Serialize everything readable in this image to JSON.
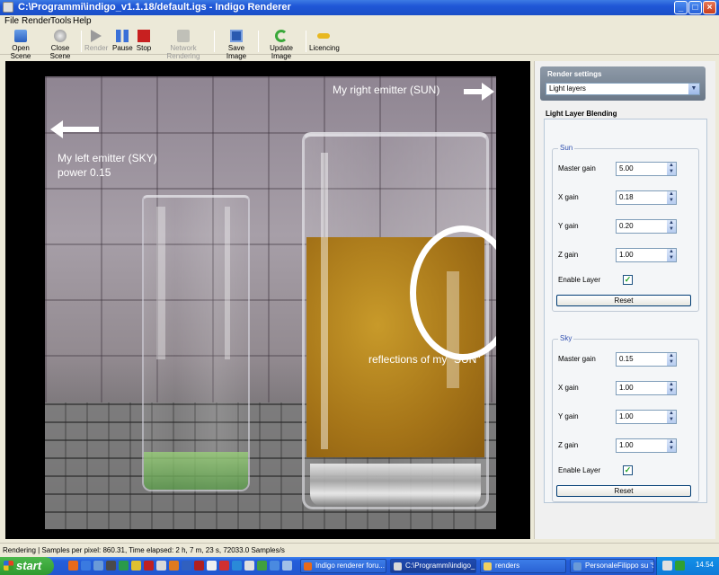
{
  "window": {
    "title": "C:\\Programmi\\indigo_v1.1.18/default.igs - Indigo Renderer"
  },
  "menu": [
    "File",
    "Render",
    "Tools",
    "Help"
  ],
  "toolbar": {
    "open_scene": "Open Scene",
    "close_scene": "Close Scene",
    "render": "Render",
    "pause": "Pause",
    "stop": "Stop",
    "network_rendering": "Network Rendering",
    "save_image": "Save Image",
    "update_image": "Update Image",
    "licencing": "Licencing"
  },
  "annotations": {
    "left_emitter_line1": "My left emitter (SKY)",
    "left_emitter_line2": "power 0.15",
    "right_emitter": "My right emitter (SUN)",
    "reflections": "reflections of my \"SUN\""
  },
  "panel": {
    "header": "Render settings",
    "dropdown_value": "Light layers",
    "section_title": "Light Layer Blending",
    "sun": {
      "title": "Sun",
      "master_gain_label": "Master gain",
      "master_gain": "5.00",
      "x_gain_label": "X gain",
      "x_gain": "0.18",
      "y_gain_label": "Y gain",
      "y_gain": "0.20",
      "z_gain_label": "Z gain",
      "z_gain": "1.00",
      "enable_label": "Enable Layer",
      "enabled": true,
      "reset": "Reset"
    },
    "sky": {
      "title": "Sky",
      "master_gain_label": "Master gain",
      "master_gain": "0.15",
      "x_gain_label": "X gain",
      "x_gain": "1.00",
      "y_gain_label": "Y gain",
      "y_gain": "1.00",
      "z_gain_label": "Z gain",
      "z_gain": "1.00",
      "enable_label": "Enable Layer",
      "enabled": true,
      "reset": "Reset"
    }
  },
  "status": "Rendering | Samples per pixel: 860.31, Time elapsed: 2 h, 7 m, 23 s, 72033.0 Samples/s",
  "taskbar": {
    "start": "start",
    "tasks": [
      "Indigo renderer foru...",
      "C:\\Programmi\\indigo_...",
      "renders",
      "PersonaleFilippo su 'S..."
    ],
    "clock": "14.54"
  },
  "colors": {
    "titlebar": "#245edb",
    "accent": "#3050b0",
    "liquid_orange": "#b07a1a",
    "liquid_green": "#7ab85a"
  }
}
